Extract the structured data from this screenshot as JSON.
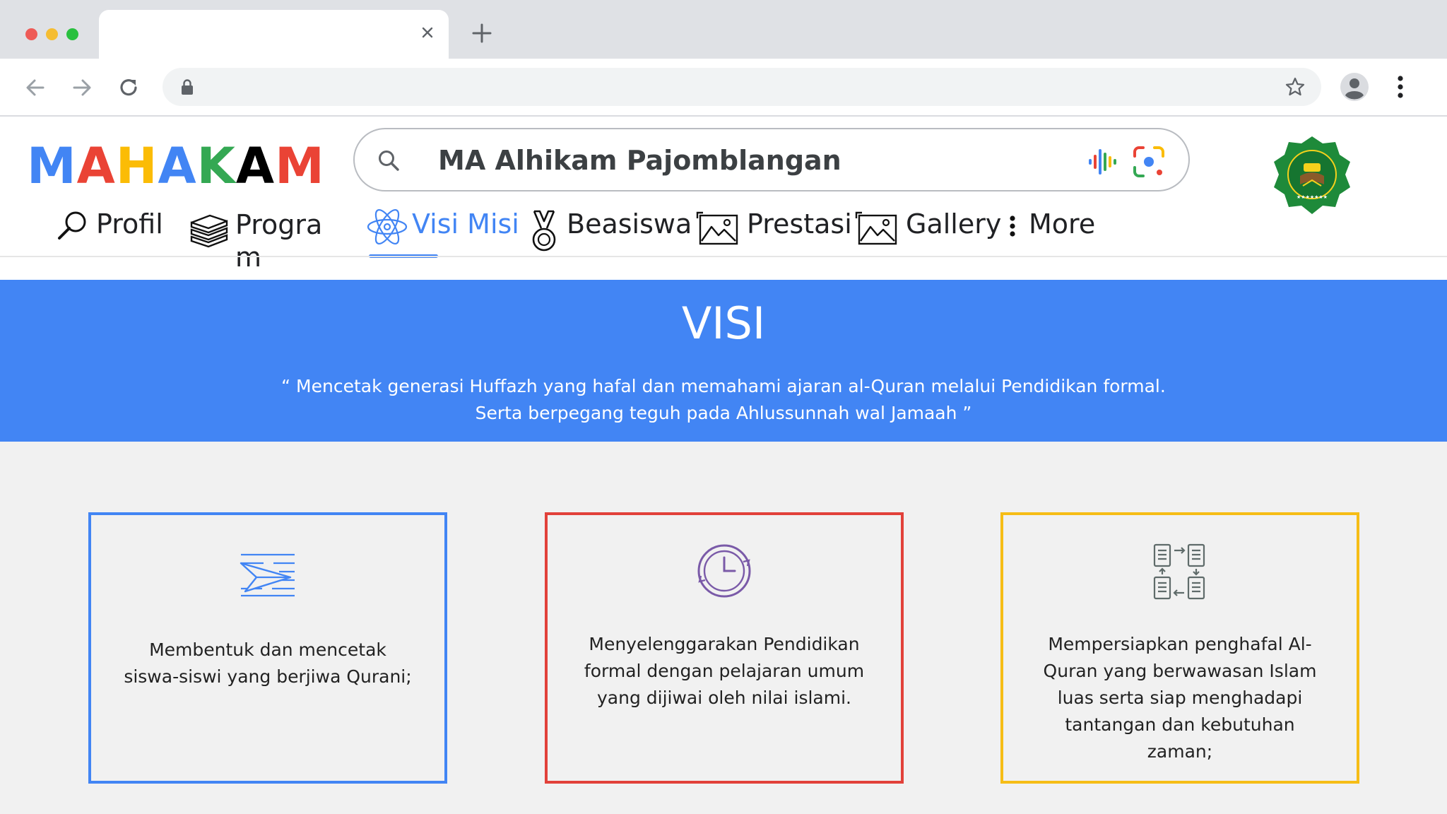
{
  "browser": {
    "tab": {
      "title": "",
      "close_icon": "close-icon"
    },
    "new_tab_icon": "plus-icon",
    "address_bar": {
      "url": "",
      "lock_icon": "lock-icon"
    }
  },
  "site": {
    "logo": {
      "text": "MAHAKAM",
      "letters": [
        {
          "ch": "M",
          "color": "#4285f4"
        },
        {
          "ch": "A",
          "color": "#ea4335"
        },
        {
          "ch": "H",
          "color": "#fbbc05"
        },
        {
          "ch": "A",
          "color": "#4285f4"
        },
        {
          "ch": "K",
          "color": "#34a853"
        },
        {
          "ch": "A",
          "color": "#000000"
        },
        {
          "ch": "M",
          "color": "#ea4335"
        }
      ]
    },
    "search": {
      "value": "MA Alhikam Pajomblangan"
    },
    "emblem": {
      "text": "MADRASAH ALIYAH ALHIKAM"
    },
    "nav": [
      {
        "label": "Profil",
        "icon": "magnifier-icon"
      },
      {
        "label": "Progra\nm",
        "icon": "books-icon"
      },
      {
        "label": "Visi Misi",
        "icon": "atom-icon",
        "active": true
      },
      {
        "label": "Beasiswa",
        "icon": "medal-icon"
      },
      {
        "label": "Prestasi",
        "icon": "picture-icon"
      },
      {
        "label": "Gallery",
        "icon": "picture-icon"
      },
      {
        "label": "More",
        "icon": "vertical-dots-icon"
      }
    ]
  },
  "visi": {
    "title": "VISI",
    "quote": "“ Mencetak generasi Huffazh yang hafal dan memahami ajaran al-Quran melalui Pendidikan formal. Serta berpegang teguh pada Ahlussunnah wal Jamaah ”"
  },
  "misi": [
    {
      "text": "Membentuk dan mencetak siswa-siswi yang berjiwa Qurani;",
      "icon": "paper-plane-icon",
      "color": "#4285f4"
    },
    {
      "text": "Menyelenggarakan Pendidikan formal dengan pelajaran umum yang dijiwai oleh nilai islami.",
      "icon": "clock-icon",
      "color": "#e2413a"
    },
    {
      "text": "Mempersiapkan penghafal Al-Quran yang berwawasan Islam luas serta siap menghadapi tantangan dan kebutuhan zaman;",
      "icon": "documents-flow-icon",
      "color": "#f6bd16"
    }
  ]
}
